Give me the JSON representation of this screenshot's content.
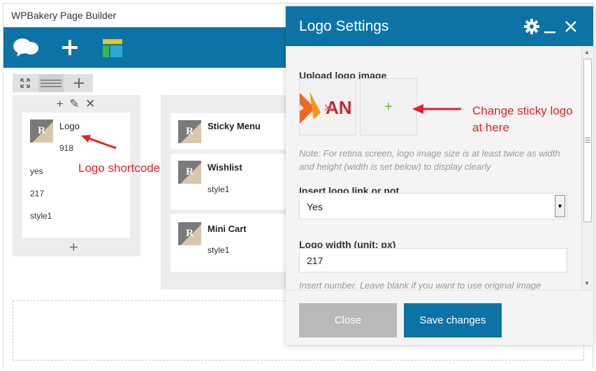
{
  "builder": {
    "title": "WPBakery Page Builder"
  },
  "toolbar": {
    "icons": [
      "clouds-logo-icon",
      "add-element-icon",
      "templates-icon"
    ]
  },
  "row_controls": {
    "icons": [
      "fullscreen-icon",
      "layout-icon",
      "add-icon"
    ]
  },
  "column1": {
    "controls": "+ ✎ ✕",
    "element": {
      "title": "Logo",
      "avatar_letter": "R",
      "values": [
        "918",
        "yes",
        "217",
        "style1"
      ]
    },
    "add": "+"
  },
  "column2": {
    "elements": [
      {
        "title": "Sticky Menu",
        "avatar_letter": "R",
        "value": ""
      },
      {
        "title": "Wishlist",
        "avatar_letter": "R",
        "value": "style1"
      },
      {
        "title": "Mini Cart",
        "avatar_letter": "R",
        "value": "style1"
      }
    ]
  },
  "annotations": {
    "logo_shortcode": "Logo shortcode",
    "sticky_line1": "Change sticky logo",
    "sticky_line2": "at here",
    "color": "#e2222a"
  },
  "modal": {
    "title": "Logo Settings",
    "upload_label": "Upload logo image",
    "logo_thumb_text": "AN",
    "add_thumb": "+",
    "retina_note": "Note: For retina screen, logo image size is at least twice as width and height (width is set below) to display clearly",
    "link_label": "Insert logo link or not",
    "link_value": "Yes",
    "width_label": "Logo width (unit: px)",
    "width_value": "217",
    "width_note": "Insert number. Leave blank if you want to use original image",
    "close_label": "Close",
    "save_label": "Save changes"
  },
  "colors": {
    "brand_blue": "#0d73a7",
    "close_button": "#b9b9b9",
    "save_button": "#0d73a7"
  }
}
